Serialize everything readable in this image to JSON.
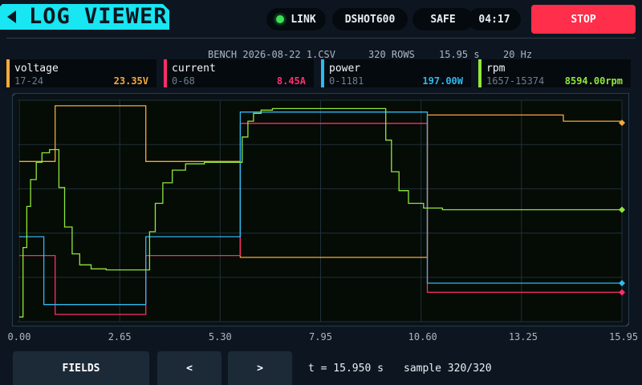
{
  "header": {
    "title": "LOG VIEWER",
    "pills": [
      {
        "label": "LINK",
        "led": "green"
      },
      {
        "label": "DSHOT600"
      },
      {
        "label": "SAFE"
      },
      {
        "label": "04:17"
      }
    ],
    "stop_label": "STOP"
  },
  "file_info": {
    "file": "BENCH_2026-08-22_1.CSV",
    "rows": "320 ROWS",
    "duration": "15.95 s",
    "rate": "20 Hz"
  },
  "fields": [
    {
      "name": "voltage",
      "range": "17-24",
      "value": "23.35V",
      "color": "#f5a93a"
    },
    {
      "name": "current",
      "range": "0-68",
      "value": "8.45A",
      "color": "#ff2e6a"
    },
    {
      "name": "power",
      "range": "0-1181",
      "value": "197.00W",
      "color": "#2fb8f0"
    },
    {
      "name": "rpm",
      "range": "1657-15374",
      "value": "8594.00rpm",
      "color": "#8fe83a"
    }
  ],
  "chart_data": {
    "type": "line",
    "x_ticks": [
      "0.00",
      "2.65",
      "5.30",
      "7.95",
      "10.60",
      "13.25",
      "15.95"
    ],
    "xlim": [
      0,
      15.95
    ],
    "series": [
      {
        "name": "voltage",
        "color": "#f5a93a",
        "ylim": [
          17,
          24
        ],
        "x": [
          0,
          0.95,
          0.95,
          3.35,
          3.35,
          5.85,
          5.85,
          10.8,
          10.8,
          14.4,
          15.95
        ],
        "y": [
          22.1,
          22.1,
          23.9,
          23.9,
          22.1,
          22.1,
          19.0,
          19.0,
          23.6,
          23.4,
          23.35
        ]
      },
      {
        "name": "current",
        "color": "#ff2e6a",
        "ylim": [
          0,
          68
        ],
        "x": [
          0,
          0.95,
          0.95,
          3.35,
          3.35,
          5.85,
          5.85,
          10.8,
          10.8,
          15.95
        ],
        "y": [
          20.0,
          20.0,
          1.5,
          1.5,
          20.0,
          20.0,
          61.5,
          61.5,
          8.45,
          8.45
        ]
      },
      {
        "name": "power",
        "color": "#2fb8f0",
        "ylim": [
          0,
          1181
        ],
        "x": [
          0,
          0.65,
          0.65,
          3.35,
          3.35,
          5.85,
          5.85,
          10.8,
          10.8,
          15.95
        ],
        "y": [
          450,
          450,
          80,
          80,
          450,
          450,
          1130,
          1130,
          197,
          197
        ]
      },
      {
        "name": "rpm",
        "color": "#8fe83a",
        "ylim": [
          1657,
          15374
        ],
        "x": [
          0,
          0.1,
          0.2,
          0.3,
          0.45,
          0.6,
          0.8,
          0.95,
          1.05,
          1.2,
          1.4,
          1.6,
          1.9,
          2.3,
          3.35,
          3.45,
          3.6,
          3.8,
          4.05,
          4.4,
          4.9,
          5.85,
          5.9,
          6.05,
          6.2,
          6.4,
          6.7,
          7.1,
          7.6,
          8.1,
          9.6,
          9.7,
          9.85,
          10.05,
          10.3,
          10.7,
          11.2,
          15.95
        ],
        "y": [
          1800,
          6200,
          8800,
          10500,
          11600,
          12200,
          12400,
          12400,
          10000,
          7500,
          5800,
          5100,
          4850,
          4780,
          4780,
          7200,
          9000,
          10300,
          11100,
          11500,
          11600,
          11600,
          13200,
          14200,
          14700,
          14900,
          15000,
          15000,
          15000,
          15000,
          15000,
          13000,
          11000,
          9800,
          9000,
          8700,
          8594,
          8594
        ]
      }
    ]
  },
  "footer": {
    "fields_label": "FIELDS",
    "prev_label": "<",
    "next_label": ">",
    "time_text": "t = 15.950 s",
    "sample_text": "sample 320/320"
  }
}
